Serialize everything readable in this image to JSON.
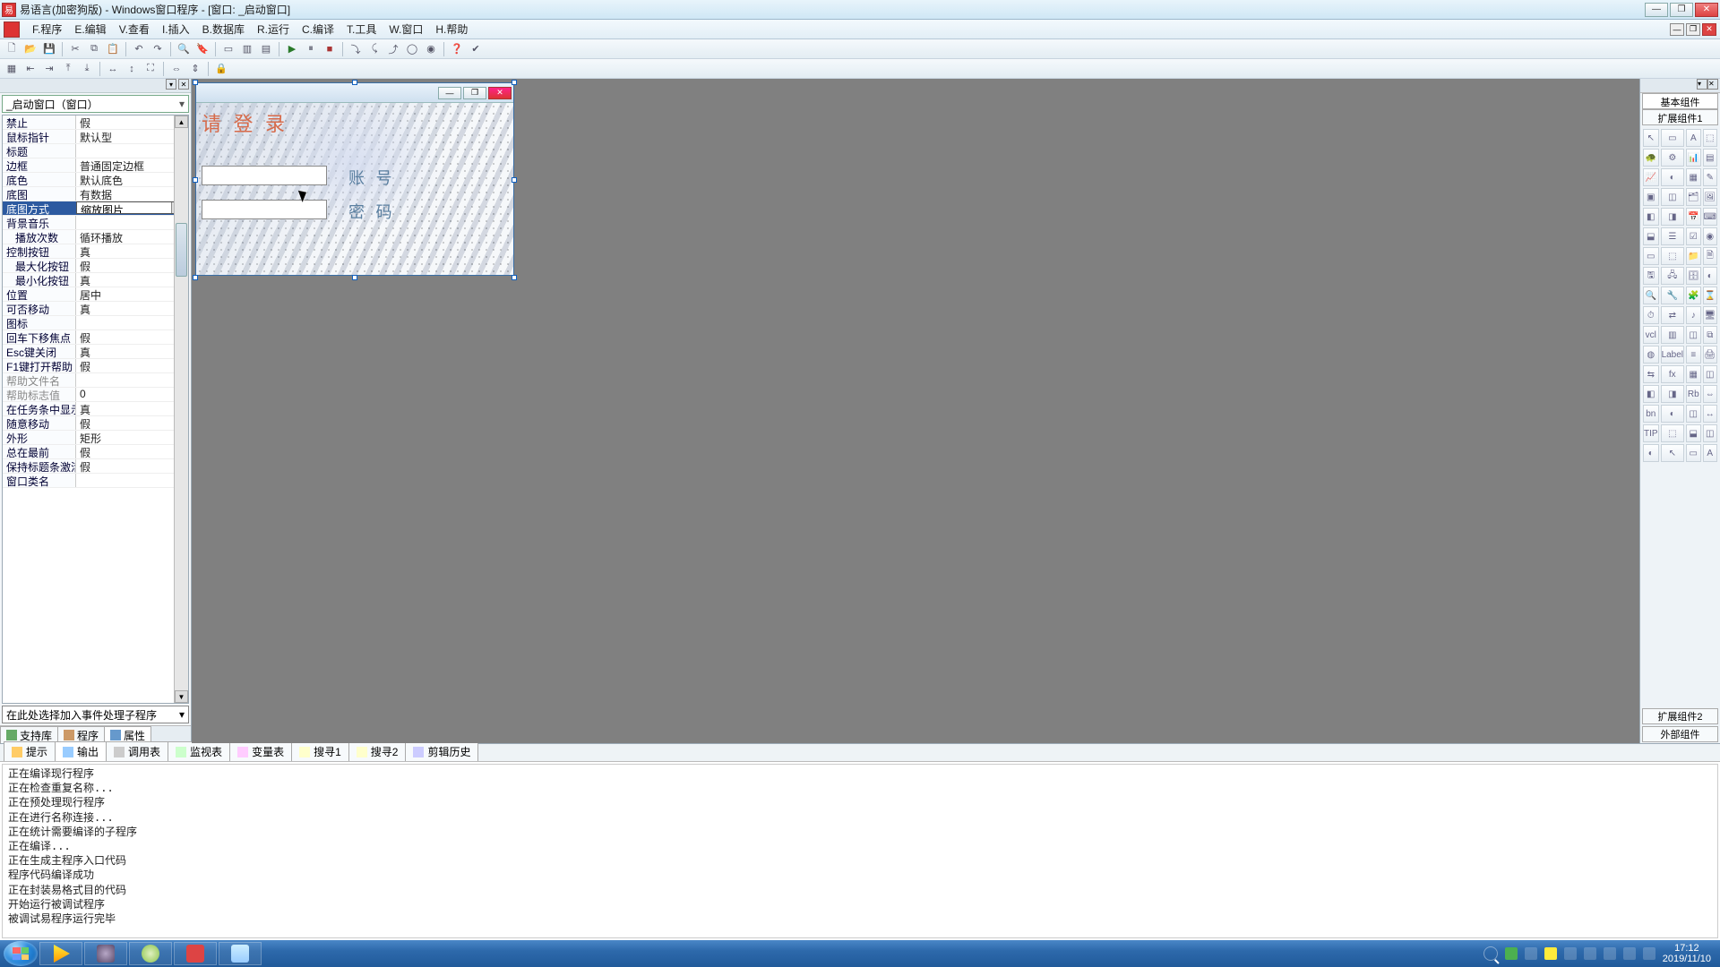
{
  "titlebar": {
    "app_name": "易语言(加密狗版)",
    "doc_title": "Windows窗口程序",
    "mdi_title": "[窗口: _启动窗口]"
  },
  "menus": {
    "program": "F.程序",
    "edit": "E.编辑",
    "view": "V.查看",
    "insert": "I.插入",
    "database": "B.数据库",
    "run": "R.运行",
    "compile": "C.编译",
    "tools": "T.工具",
    "window": "W.窗口",
    "help": "H.帮助"
  },
  "left": {
    "object_selector": "_启动窗口（窗口）",
    "event_selector": "在此处选择加入事件处理子程序",
    "tabs": {
      "support": "支持库",
      "program": "程序",
      "props": "属性"
    },
    "props": [
      {
        "n": "禁止",
        "v": "假"
      },
      {
        "n": "鼠标指针",
        "v": "默认型"
      },
      {
        "n": "标题",
        "v": ""
      },
      {
        "n": "边框",
        "v": "普通固定边框"
      },
      {
        "n": "底色",
        "v": "默认底色"
      },
      {
        "n": "底图",
        "v": "有数据"
      },
      {
        "n": "底图方式",
        "v": "缩放图片",
        "sel": true
      },
      {
        "n": "背景音乐",
        "v": ""
      },
      {
        "n": "播放次数",
        "v": "循环播放",
        "indent": true
      },
      {
        "n": "控制按钮",
        "v": "真"
      },
      {
        "n": "最大化按钮",
        "v": "假",
        "indent": true
      },
      {
        "n": "最小化按钮",
        "v": "真",
        "indent": true
      },
      {
        "n": "位置",
        "v": "居中"
      },
      {
        "n": "可否移动",
        "v": "真"
      },
      {
        "n": "图标",
        "v": ""
      },
      {
        "n": "回车下移焦点",
        "v": "假"
      },
      {
        "n": "Esc键关闭",
        "v": "真"
      },
      {
        "n": "F1键打开帮助",
        "v": "假"
      },
      {
        "n": "帮助文件名",
        "v": "",
        "grey": true
      },
      {
        "n": "帮助标志值",
        "v": "0",
        "grey": true
      },
      {
        "n": "在任务条中显示",
        "v": "真"
      },
      {
        "n": "随意移动",
        "v": "假"
      },
      {
        "n": "外形",
        "v": "矩形"
      },
      {
        "n": "总在最前",
        "v": "假"
      },
      {
        "n": "保持标题条激活",
        "v": "假"
      },
      {
        "n": "窗口类名",
        "v": ""
      }
    ]
  },
  "designform": {
    "login_label": "请 登 录",
    "account_label": "账 号",
    "password_label": "密 码"
  },
  "right": {
    "tab_basic": "基本组件",
    "tab_ext1": "扩展组件1",
    "tab_ext2": "扩展组件2",
    "tab_external": "外部组件"
  },
  "bottom": {
    "tabs": {
      "tips": "提示",
      "output": "输出",
      "calltable": "调用表",
      "watch": "监视表",
      "vars": "变量表",
      "search1": "搜寻1",
      "search2": "搜寻2",
      "clip": "剪辑历史"
    },
    "lines": [
      "正在编译现行程序",
      "正在检查重复名称...",
      "正在预处理现行程序",
      "正在进行名称连接...",
      "正在统计需要编译的子程序",
      "正在编译...",
      "正在生成主程序入口代码",
      "程序代码编译成功",
      "正在封装易格式目的代码",
      "开始运行被调试程序",
      "被调试易程序运行完毕"
    ]
  },
  "taskbar": {
    "time": "17:12",
    "date": "2019/11/10"
  }
}
